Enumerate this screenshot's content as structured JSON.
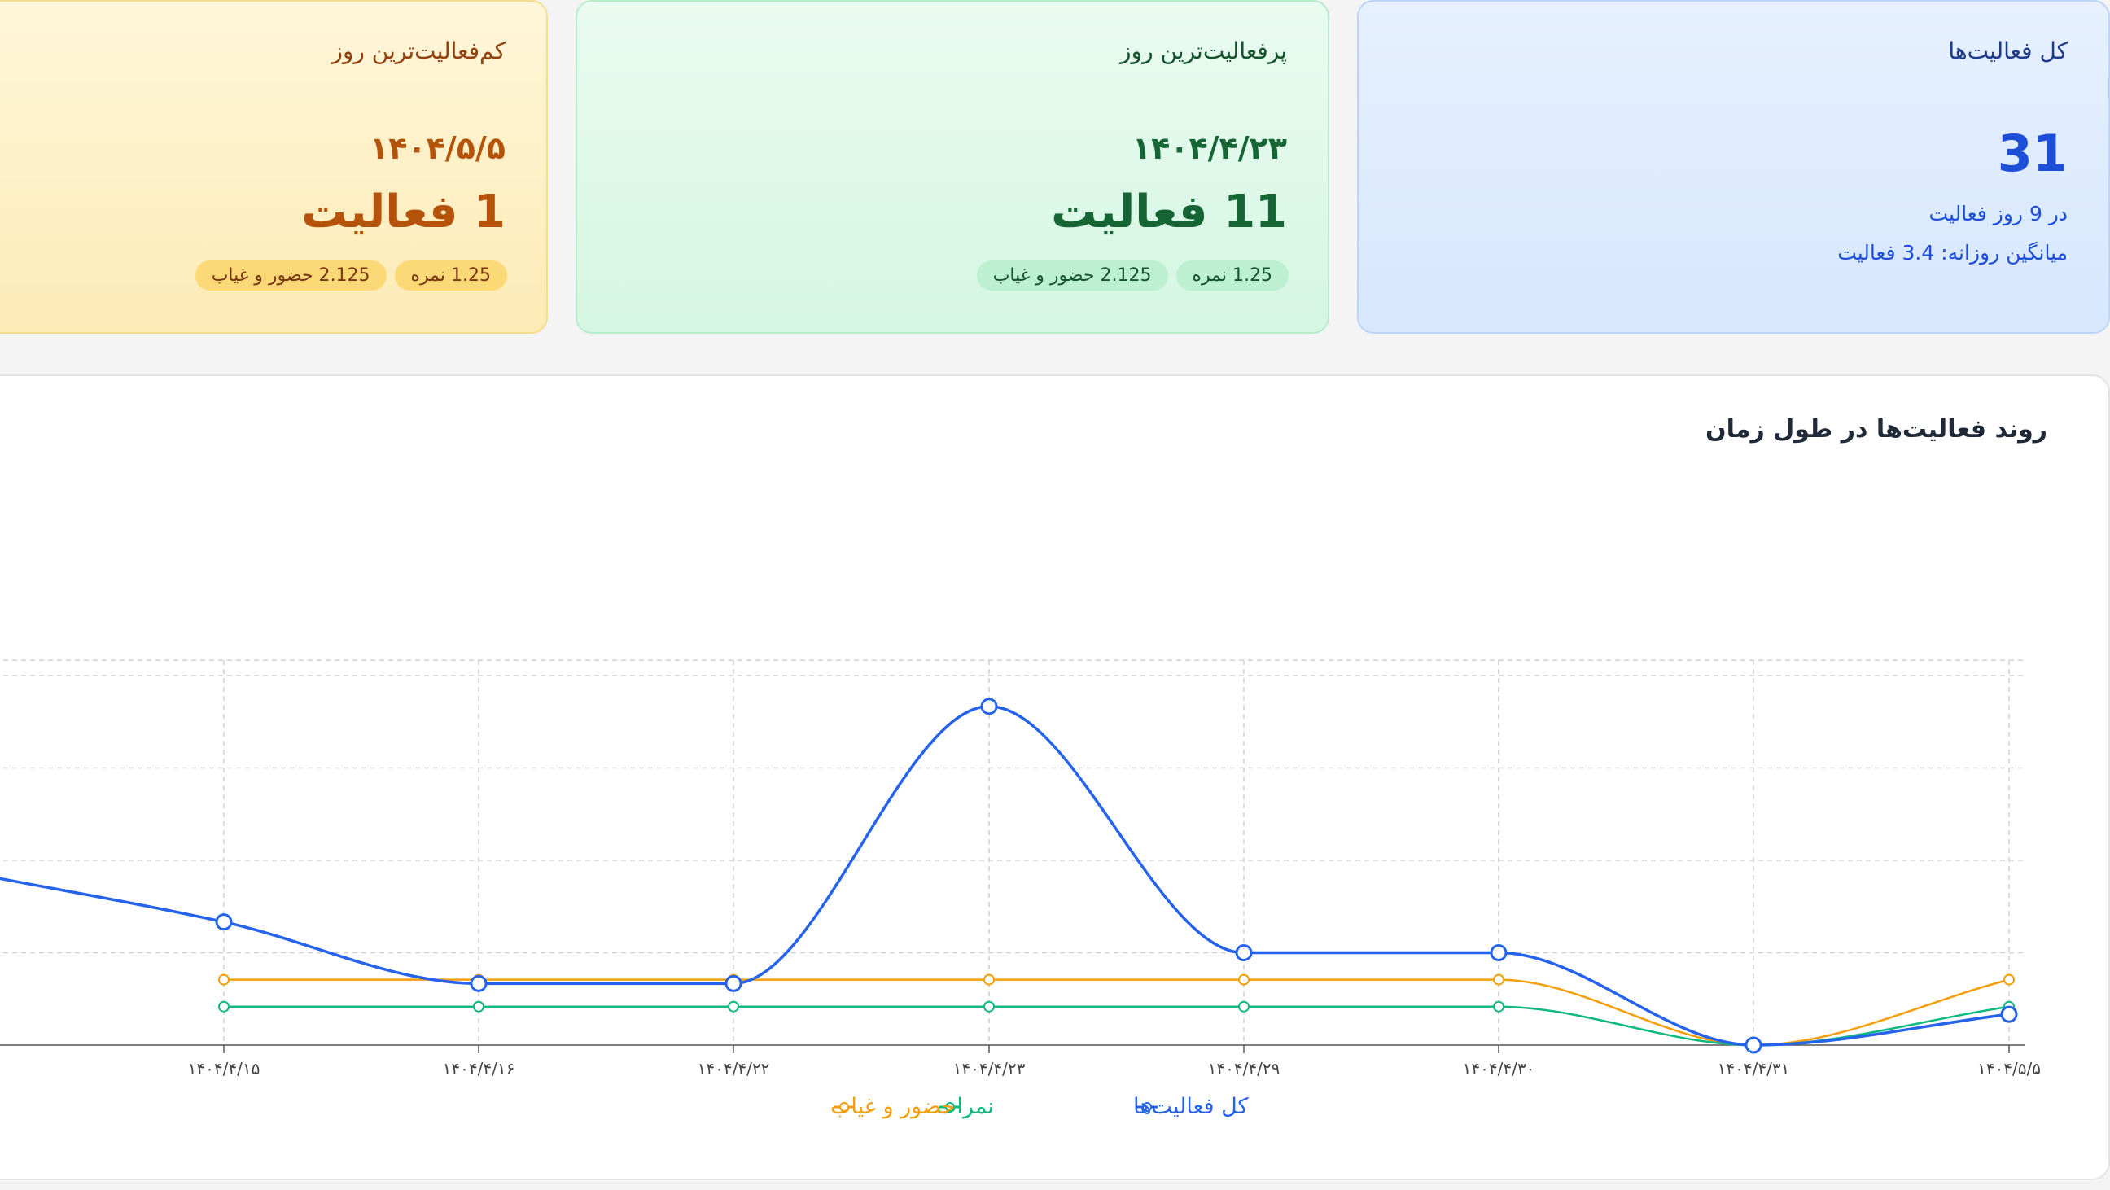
{
  "cards": {
    "total": {
      "title": "کل فعالیت‌ها",
      "value": "31",
      "days_line": "در 9 روز فعالیت",
      "avg_line": "میانگین روزانه: 3.4 فعالیت"
    },
    "most_active": {
      "title": "پرفعالیت‌ترین روز",
      "date": "۱۴۰۴/۴/۲۳",
      "count": "11 فعالیت",
      "badges": [
        "1.25 نمره",
        "2.125 حضور و غیاب"
      ]
    },
    "least_active": {
      "title": "کم‌فعالیت‌ترین روز",
      "date": "۱۴۰۴/۵/۵",
      "count": "1 فعالیت",
      "badges": [
        "1.25 نمره",
        "2.125 حضور و غیاب"
      ]
    }
  },
  "colors": {
    "total": "#2563eb",
    "grades": "#10b981",
    "attendance": "#f59e0b",
    "grid": "#cfcfcf",
    "axis": "#555555"
  },
  "chart_data": {
    "type": "line",
    "title": "روند فعالیت‌ها در طول زمان",
    "x": [
      "۱۴۰۴/۴/۱۵",
      "۱۴۰۴/۴/۱۶",
      "۱۴۰۴/۴/۲۲",
      "۱۴۰۴/۴/۲۳",
      "۱۴۰۴/۴/۲۹",
      "۱۴۰۴/۴/۳۰",
      "۱۴۰۴/۴/۳۱",
      "۱۴۰۴/۵/۵"
    ],
    "series": [
      {
        "name": "کل فعالیت‌ها",
        "values": [
          4,
          2,
          2,
          11,
          3,
          3,
          0,
          1
        ]
      },
      {
        "name": "نمرات",
        "values": [
          1.25,
          1.25,
          1.25,
          1.25,
          1.25,
          1.25,
          0,
          1.25
        ]
      },
      {
        "name": "حضور و غیاب",
        "values": [
          2.125,
          2.125,
          2.125,
          2.125,
          2.125,
          2.125,
          0,
          2.125
        ]
      }
    ],
    "ylim": [
      0,
      12
    ],
    "grid": true,
    "legend": "bottom-center",
    "curve": "smooth"
  }
}
